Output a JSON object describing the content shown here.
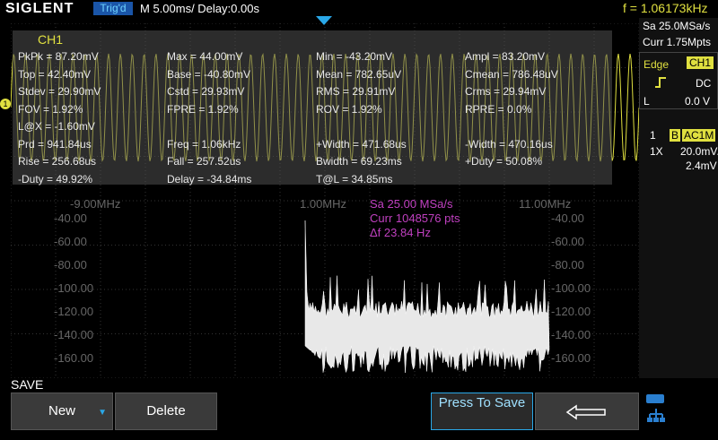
{
  "topbar": {
    "logo": "SIGLENT",
    "trig_state": "Trig'd",
    "timebase": "M 5.00ms/ Delay:0.00s",
    "frequency": "f = 1.06173kHz"
  },
  "measurements": {
    "title": "CH1",
    "rows": [
      [
        "PkPk = 87.20mV",
        "Max = 44.00mV",
        "Min = -43.20mV",
        "Ampl = 83.20mV"
      ],
      [
        "Top = 42.40mV",
        "Base = -40.80mV",
        "Mean = 782.65uV",
        "Cmean = 786.48uV"
      ],
      [
        "Stdev = 29.90mV",
        "Cstd = 29.93mV",
        "RMS = 29.91mV",
        "Crms = 29.94mV"
      ],
      [
        "FOV = 1.92%",
        "FPRE = 1.92%",
        "ROV = 1.92%",
        "RPRE = 0.0%"
      ],
      [
        "L@X = -1.60mV",
        "",
        "",
        ""
      ],
      [
        "Prd = 941.84us",
        "Freq = 1.06kHz",
        "+Width = 471.68us",
        "-Width = 470.16us"
      ],
      [
        "Rise = 256.68us",
        "Fall = 257.52us",
        "Bwidth = 69.23ms",
        "+Duty = 50.08%"
      ],
      [
        "-Duty = 49.92%",
        "Delay = -34.84ms",
        "T@L = 34.85ms",
        ""
      ]
    ]
  },
  "fft": {
    "x_labels": [
      "-9.00MHz",
      "1.00MHz",
      "11.00MHz"
    ],
    "y_labels": [
      "-40.00",
      "-60.00",
      "-80.00",
      "-100.00",
      "-120.00",
      "-140.00",
      "-160.00"
    ],
    "info": [
      "Sa 25.00 MSa/s",
      "Curr 1048576 pts",
      "Δf 23.84 Hz"
    ]
  },
  "right_panel": {
    "sample_rate": "Sa 25.0MSa/s",
    "curr": "Curr 1.75Mpts",
    "trigger_type": "Edge",
    "trigger_source": "CH1",
    "coupling": "DC",
    "level_label": "L",
    "level_value": "0.0 V",
    "ch_num": "1",
    "bw_label": "B",
    "ch_coupling": "AC1M",
    "probe": "1X",
    "vdiv": "20.0mV/",
    "offset": "2.4mV"
  },
  "softkeys": {
    "menu_label": "SAVE",
    "new": "New",
    "delete": "Delete",
    "press_to_save": "Press To Save"
  },
  "colors": {
    "ch1": "#e0e040",
    "fft_info": "#c040c0",
    "accent": "#2aa8e8"
  }
}
